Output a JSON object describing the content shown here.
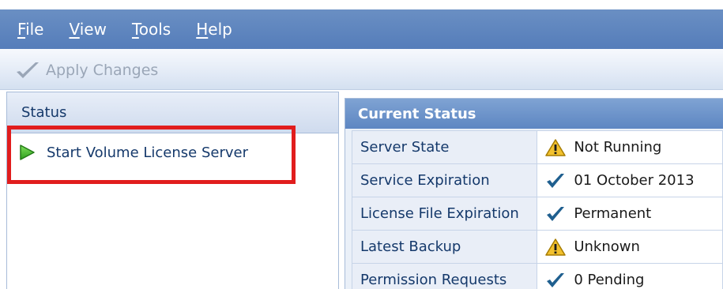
{
  "menu": {
    "items": [
      {
        "label": "File",
        "accel": "F",
        "rest": "ile"
      },
      {
        "label": "View",
        "accel": "V",
        "rest": "iew"
      },
      {
        "label": "Tools",
        "accel": "T",
        "rest": "ools"
      },
      {
        "label": "Help",
        "accel": "H",
        "rest": "elp"
      }
    ]
  },
  "toolbar": {
    "apply_label": "Apply Changes",
    "apply_icon": "check-icon"
  },
  "left_panel": {
    "title": "Status",
    "start_link_label": "Start Volume License Server",
    "start_icon": "play-icon",
    "highlight_color": "#e11d1d"
  },
  "right_panel": {
    "title": "Current Status",
    "rows": [
      {
        "label": "Server State",
        "value": "Not Running",
        "icon": "warning-icon"
      },
      {
        "label": "Service Expiration",
        "value": "01 October 2013",
        "icon": "check-icon"
      },
      {
        "label": "License File Expiration",
        "value": "Permanent",
        "icon": "check-icon"
      },
      {
        "label": "Latest Backup",
        "value": "Unknown",
        "icon": "warning-icon"
      },
      {
        "label": "Permission Requests",
        "value": "0 Pending",
        "icon": "check-icon"
      }
    ]
  },
  "colors": {
    "menubar": "#557dba",
    "header": "#5d86c2",
    "text_primary": "#15396b",
    "warning": "#f2c12e",
    "check": "#1f5f8f"
  }
}
